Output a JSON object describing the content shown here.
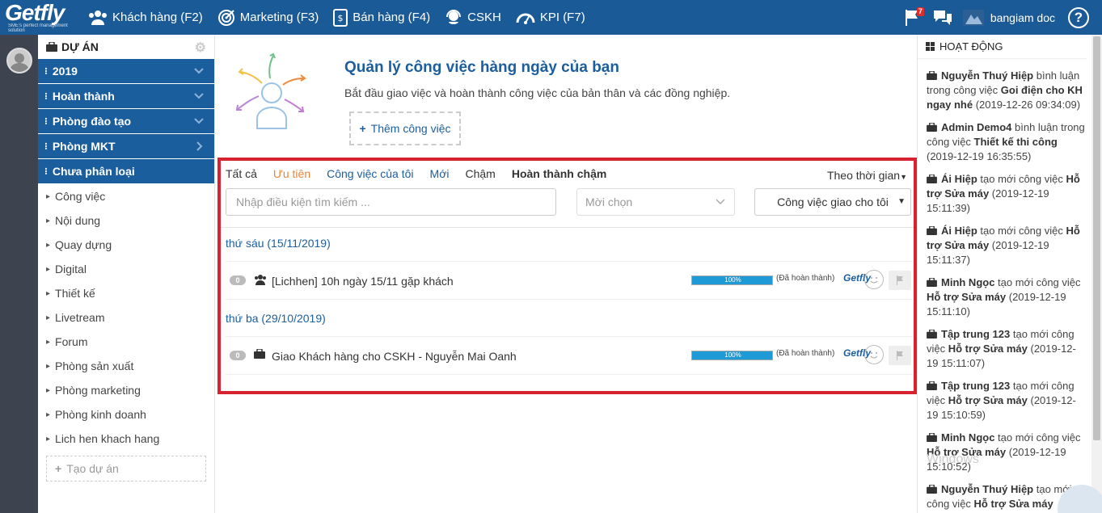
{
  "brand": {
    "logo": "Getfly",
    "tagline": "SME's perfect management solution"
  },
  "nav": [
    {
      "label": "Khách hàng (F2)",
      "icon": "users-icon"
    },
    {
      "label": "Marketing (F3)",
      "icon": "target-icon"
    },
    {
      "label": "Bán hàng (F4)",
      "icon": "sales-icon"
    },
    {
      "label": "CSKH",
      "icon": "headset-icon"
    },
    {
      "label": "KPI (F7)",
      "icon": "gauge-icon"
    }
  ],
  "topright": {
    "flag_badge": "7",
    "username": "bangiam doc",
    "help": "?"
  },
  "sidebar": {
    "title": "DỰ ÁN",
    "groups": [
      {
        "label": "2019"
      },
      {
        "label": "Hoàn thành"
      },
      {
        "label": "Phòng đào tạo"
      },
      {
        "label": "Phòng MKT"
      },
      {
        "label": "Chưa phân loại"
      }
    ],
    "items": [
      "Công việc",
      "Nội dung",
      "Quay dựng",
      "Digital",
      "Thiết kế",
      "Livetream",
      "Forum",
      "Phòng sản xuất",
      "Phòng marketing",
      "Phòng kinh doanh",
      "Lich hen khach hang"
    ],
    "create_label": "Tạo dự án"
  },
  "hero": {
    "title": "Quản lý công việc hàng ngày của bạn",
    "subtitle": "Bắt đầu giao việc và hoàn thành công việc của bản thân và các đồng nghiệp.",
    "add_label": "Thêm công việc"
  },
  "filters": {
    "all": "Tất cả",
    "priority": "Ưu tiên",
    "mine": "Công việc của tôi",
    "new": "Mới",
    "late": "Chậm",
    "done_late": "Hoàn thành chậm",
    "sort": "Theo thời gian"
  },
  "search": {
    "placeholder": "Nhập điều kiện tìm kiếm ..."
  },
  "select1": {
    "placeholder": "Mời chọn"
  },
  "select2": {
    "value": "Công việc giao cho tôi"
  },
  "groups": [
    {
      "date": "thứ sáu (15/11/2019)",
      "task": {
        "count": "0",
        "name": "[Lichhen] 10h ngày 15/11 gặp khách",
        "progress": 100,
        "progress_label": "100%",
        "status": "(Đã hoàn thành)",
        "type_icon": "group-icon"
      }
    },
    {
      "date": "thứ ba (29/10/2019)",
      "task": {
        "count": "0",
        "name": "Giao Khách hàng cho CSKH - Nguyễn Mai Oanh",
        "progress": 100,
        "progress_label": "100%",
        "status": "(Đã hoàn thành)",
        "type_icon": "briefcase-icon"
      }
    }
  ],
  "mini_logo": "Getfly",
  "activity": {
    "title": "HOẠT ĐỘNG",
    "items": [
      {
        "actor": "Nguyễn Thuý Hiệp",
        "action": " bình luận trong công việc ",
        "target": "Goi điện cho KH ngay nhé",
        "time": " (2019-12-26 09:34:09)"
      },
      {
        "actor": "Admin Demo4",
        "action": " bình luận trong công việc ",
        "target": "Thiết kế thi công",
        "time": " (2019-12-19 16:35:55)"
      },
      {
        "actor": "Ái Hiệp",
        "action": " tạo mới công việc ",
        "target": "Hỗ trợ Sửa máy",
        "time": " (2019-12-19 15:11:39)"
      },
      {
        "actor": "Ái Hiệp",
        "action": " tạo mới công việc ",
        "target": "Hỗ trợ Sửa máy",
        "time": " (2019-12-19 15:11:37)"
      },
      {
        "actor": "Minh Ngọc",
        "action": " tạo mới công việc ",
        "target": "Hỗ trợ Sửa máy",
        "time": " (2019-12-19 15:11:10)"
      },
      {
        "actor": "Tập trung 123",
        "action": " tạo mới công việc ",
        "target": "Hỗ trợ Sửa máy",
        "time": " (2019-12-19 15:11:07)"
      },
      {
        "actor": "Tập trung 123",
        "action": " tạo mới công việc ",
        "target": "Hỗ trợ Sửa máy",
        "time": " (2019-12-19 15:10:59)"
      },
      {
        "actor": "Minh Ngọc",
        "action": " tạo mới công việc ",
        "target": "Hỗ trợ Sửa máy",
        "time": " (2019-12-19 15:10:52)"
      },
      {
        "actor": "Nguyễn Thuý Hiệp",
        "action": " tạo mới công việc ",
        "target": "Hỗ trợ Sửa máy",
        "time": ""
      }
    ]
  },
  "watermark": "Windows",
  "colors": {
    "primary": "#1b5e9e",
    "topbar": "#1a5a96",
    "highlight": "#d6232f",
    "accent": "#e8853b",
    "progress": "#1e9ad6"
  }
}
